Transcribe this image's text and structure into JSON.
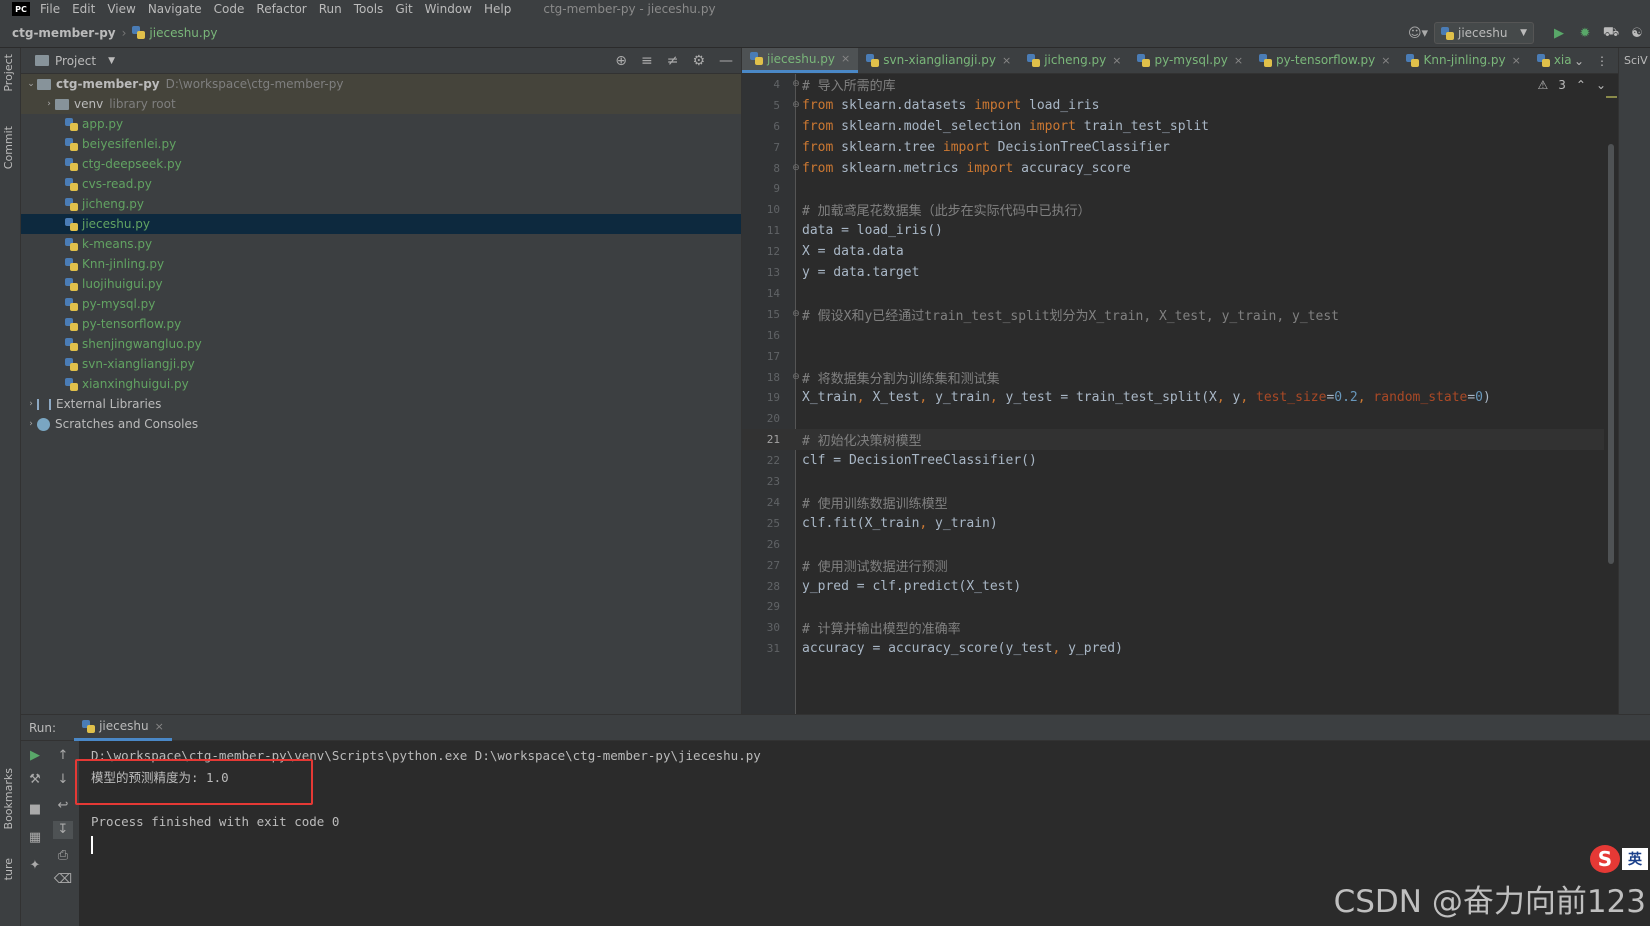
{
  "app": {
    "logo_text": "PC",
    "window_title": "ctg-member-py - jieceshu.py",
    "menu": [
      "File",
      "Edit",
      "View",
      "Navigate",
      "Code",
      "Refactor",
      "Run",
      "Tools",
      "Git",
      "Window",
      "Help"
    ]
  },
  "navbar": {
    "project": "ctg-member-py",
    "separator": "›",
    "file": "jieceshu.py",
    "run_config": "jieceshu"
  },
  "left_stripe": {
    "project_tab": "Project",
    "commit_tab": "Commit",
    "bookmarks_tab": "Bookmarks",
    "structure_tab": "ture"
  },
  "project_panel": {
    "title": "Project",
    "tree": [
      {
        "label": "ctg-member-py",
        "path": "D:\\workspace\\ctg-member-py",
        "kind": "root"
      },
      {
        "label": "venv",
        "path": "library root",
        "kind": "folder"
      },
      {
        "label": "app.py",
        "kind": "file"
      },
      {
        "label": "beiyesifenlei.py",
        "kind": "file"
      },
      {
        "label": "ctg-deepseek.py",
        "kind": "file"
      },
      {
        "label": "cvs-read.py",
        "kind": "file"
      },
      {
        "label": "jicheng.py",
        "kind": "file"
      },
      {
        "label": "jieceshu.py",
        "kind": "file",
        "selected": true
      },
      {
        "label": "k-means.py",
        "kind": "file"
      },
      {
        "label": "Knn-jinling.py",
        "kind": "file"
      },
      {
        "label": "luojihuigui.py",
        "kind": "file"
      },
      {
        "label": "py-mysql.py",
        "kind": "file"
      },
      {
        "label": "py-tensorflow.py",
        "kind": "file"
      },
      {
        "label": "shenjingwangluo.py",
        "kind": "file"
      },
      {
        "label": "svn-xiangliangji.py",
        "kind": "file"
      },
      {
        "label": "xianxinghuigui.py",
        "kind": "file"
      },
      {
        "label": "External Libraries",
        "kind": "lib"
      },
      {
        "label": "Scratches and Consoles",
        "kind": "scratch"
      }
    ]
  },
  "editor": {
    "tabs": [
      {
        "label": "jieceshu.py",
        "active": true
      },
      {
        "label": "svn-xiangliangji.py"
      },
      {
        "label": "jicheng.py"
      },
      {
        "label": "py-mysql.py"
      },
      {
        "label": "py-tensorflow.py"
      },
      {
        "label": "Knn-jinling.py"
      },
      {
        "label": "xia"
      }
    ],
    "close_glyph": "×",
    "inspection_count": "3",
    "current_line": 21,
    "lines": [
      {
        "n": 4,
        "tokens": [
          {
            "t": "# 导入所需的库",
            "c": "cm"
          }
        ],
        "fold": true
      },
      {
        "n": 5,
        "tokens": [
          {
            "t": "from",
            "c": "kw"
          },
          {
            "t": " sklearn.datasets "
          },
          {
            "t": "import",
            "c": "kw"
          },
          {
            "t": " load_iris"
          }
        ],
        "fold": true
      },
      {
        "n": 6,
        "tokens": [
          {
            "t": "from",
            "c": "kw"
          },
          {
            "t": " sklearn.model_selection "
          },
          {
            "t": "import",
            "c": "kw"
          },
          {
            "t": " train_test_split"
          }
        ]
      },
      {
        "n": 7,
        "tokens": [
          {
            "t": "from",
            "c": "kw"
          },
          {
            "t": " sklearn.tree "
          },
          {
            "t": "import",
            "c": "kw"
          },
          {
            "t": " DecisionTreeClassifier"
          }
        ]
      },
      {
        "n": 8,
        "tokens": [
          {
            "t": "from",
            "c": "kw"
          },
          {
            "t": " sklearn.metrics "
          },
          {
            "t": "import",
            "c": "kw"
          },
          {
            "t": " accuracy_score"
          }
        ],
        "fold": true
      },
      {
        "n": 9,
        "tokens": []
      },
      {
        "n": 10,
        "tokens": [
          {
            "t": "# 加载鸢尾花数据集（此步在实际代码中已执行）",
            "c": "cm"
          }
        ]
      },
      {
        "n": 11,
        "tokens": [
          {
            "t": "data = load_iris()"
          }
        ]
      },
      {
        "n": 12,
        "tokens": [
          {
            "t": "X = data.data"
          }
        ]
      },
      {
        "n": 13,
        "tokens": [
          {
            "t": "y = data.target"
          }
        ]
      },
      {
        "n": 14,
        "tokens": []
      },
      {
        "n": 15,
        "tokens": [
          {
            "t": "# 假设X和y已经通过train_test_split划分为X_train, X_test, y_train, y_test",
            "c": "cm"
          }
        ],
        "fold": true
      },
      {
        "n": 16,
        "tokens": []
      },
      {
        "n": 17,
        "tokens": []
      },
      {
        "n": 18,
        "tokens": [
          {
            "t": "# 将数据集分割为训练集和测试集",
            "c": "cm"
          }
        ],
        "fold": true
      },
      {
        "n": 19,
        "tokens": [
          {
            "t": "X_train"
          },
          {
            "t": ",",
            "c": "comma"
          },
          {
            "t": " X_test"
          },
          {
            "t": ",",
            "c": "comma"
          },
          {
            "t": " y_train"
          },
          {
            "t": ",",
            "c": "comma"
          },
          {
            "t": " y_test = train_test_split(X"
          },
          {
            "t": ",",
            "c": "comma"
          },
          {
            "t": " y"
          },
          {
            "t": ",",
            "c": "comma"
          },
          {
            "t": " "
          },
          {
            "t": "test_size",
            "c": "param"
          },
          {
            "t": "="
          },
          {
            "t": "0.2",
            "c": "num"
          },
          {
            "t": ",",
            "c": "comma"
          },
          {
            "t": " "
          },
          {
            "t": "random_state",
            "c": "param"
          },
          {
            "t": "="
          },
          {
            "t": "0",
            "c": "num"
          },
          {
            "t": ")"
          }
        ]
      },
      {
        "n": 20,
        "tokens": []
      },
      {
        "n": 21,
        "tokens": [
          {
            "t": "# 初始化决策树模型",
            "c": "cm"
          }
        ]
      },
      {
        "n": 22,
        "tokens": [
          {
            "t": "clf = DecisionTreeClassifier()"
          }
        ]
      },
      {
        "n": 23,
        "tokens": []
      },
      {
        "n": 24,
        "tokens": [
          {
            "t": "# 使用训练数据训练模型",
            "c": "cm"
          }
        ]
      },
      {
        "n": 25,
        "tokens": [
          {
            "t": "clf.fit(X_train"
          },
          {
            "t": ",",
            "c": "comma"
          },
          {
            "t": " y_train)"
          }
        ]
      },
      {
        "n": 26,
        "tokens": []
      },
      {
        "n": 27,
        "tokens": [
          {
            "t": "# 使用测试数据进行预测",
            "c": "cm"
          }
        ]
      },
      {
        "n": 28,
        "tokens": [
          {
            "t": "y_pred = clf.predict(X_test)"
          }
        ]
      },
      {
        "n": 29,
        "tokens": []
      },
      {
        "n": 30,
        "tokens": [
          {
            "t": "# 计算并输出模型的准确率",
            "c": "cm"
          }
        ]
      },
      {
        "n": 31,
        "tokens": [
          {
            "t": "accuracy = accuracy_score(y_test"
          },
          {
            "t": ",",
            "c": "comma"
          },
          {
            "t": " y_pred)"
          }
        ]
      }
    ]
  },
  "right_stripe": {
    "label": "SciV"
  },
  "run_panel": {
    "label": "Run:",
    "tab": "jieceshu",
    "console": [
      "D:\\workspace\\ctg-member-py\\venv\\Scripts\\python.exe D:\\workspace\\ctg-member-py\\jieceshu.py",
      "模型的预测精度为: 1.0",
      "",
      "Process finished with exit code 0"
    ]
  },
  "ime": {
    "logo": "S",
    "lang": "英"
  },
  "watermark": "CSDN @奋力向前123",
  "colors": {
    "keyword": "#cc7832",
    "comment": "#808080",
    "number": "#6897bb",
    "param": "#aa4926",
    "file_green": "#62a362",
    "highlight_box": "#e53935",
    "accent": "#4a88c7"
  }
}
